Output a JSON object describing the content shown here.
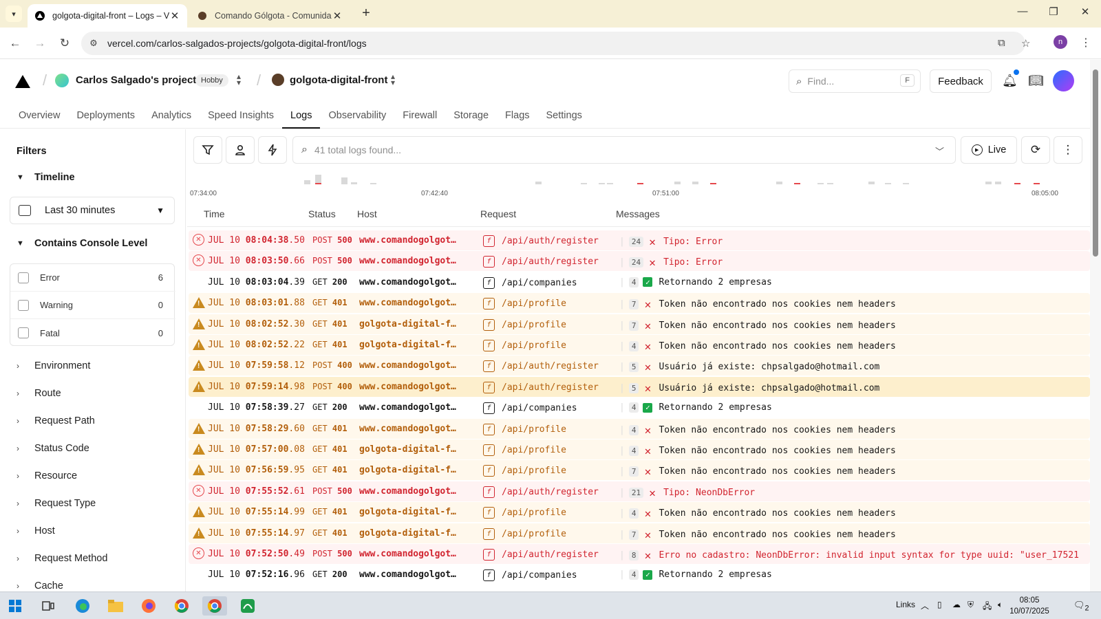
{
  "browser": {
    "tabs": [
      {
        "title": "golgota-digital-front – Logs – V",
        "active": true
      },
      {
        "title": "Comando Gólgota - Comunidad",
        "active": false
      }
    ],
    "url": "vercel.com/carlos-salgados-projects/golgota-digital-front/logs",
    "profile_initial": "n"
  },
  "header": {
    "project_owner": "Carlos Salgado's projects",
    "plan_badge": "Hobby",
    "repo": "golgota-digital-front",
    "find_placeholder": "Find...",
    "find_shortcut": "F",
    "feedback_label": "Feedback",
    "nav_tabs": [
      "Overview",
      "Deployments",
      "Analytics",
      "Speed Insights",
      "Logs",
      "Observability",
      "Firewall",
      "Storage",
      "Flags",
      "Settings"
    ],
    "active_tab": "Logs"
  },
  "sidebar": {
    "title": "Filters",
    "timeline_label": "Timeline",
    "timeline_value": "Last 30 minutes",
    "console_level_label": "Contains Console Level",
    "levels": [
      {
        "label": "Error",
        "count": "6"
      },
      {
        "label": "Warning",
        "count": "0"
      },
      {
        "label": "Fatal",
        "count": "0"
      }
    ],
    "filters": [
      "Environment",
      "Route",
      "Request Path",
      "Status Code",
      "Resource",
      "Request Type",
      "Host",
      "Request Method",
      "Cache"
    ]
  },
  "toolbar": {
    "search_placeholder": "41 total logs found...",
    "live_label": "Live"
  },
  "timeline_labels": [
    "07:34:00",
    "07:42:40",
    "07:51:00",
    "08:05:00"
  ],
  "table": {
    "headers": [
      "Time",
      "Status",
      "Host",
      "Request",
      "Messages"
    ],
    "rows": [
      {
        "level": "err",
        "date": "JUL 10",
        "time": "08:04:38",
        "ms": ".50",
        "method": "POST",
        "status": "500",
        "host": "www.comandogolgot…",
        "path": "/api/auth/register",
        "count": "24",
        "icon": "x",
        "message": "Tipo: Error"
      },
      {
        "level": "err",
        "date": "JUL 10",
        "time": "08:03:50",
        "ms": ".66",
        "method": "POST",
        "status": "500",
        "host": "www.comandogolgot…",
        "path": "/api/auth/register",
        "count": "24",
        "icon": "x",
        "message": "Tipo: Error"
      },
      {
        "level": "ok",
        "date": "JUL 10",
        "time": "08:03:04",
        "ms": ".39",
        "method": "GET",
        "status": "200",
        "host": "www.comandogolgot…",
        "path": "/api/companies",
        "count": "4",
        "icon": "check",
        "message": "Retornando 2 empresas"
      },
      {
        "level": "warn",
        "date": "JUL 10",
        "time": "08:03:01",
        "ms": ".88",
        "method": "GET",
        "status": "401",
        "host": "www.comandogolgot…",
        "path": "/api/profile",
        "count": "7",
        "icon": "x",
        "message": "Token não encontrado nos cookies nem headers"
      },
      {
        "level": "warn",
        "date": "JUL 10",
        "time": "08:02:52",
        "ms": ".30",
        "method": "GET",
        "status": "401",
        "host": "golgota-digital-f…",
        "path": "/api/profile",
        "count": "7",
        "icon": "x",
        "message": "Token não encontrado nos cookies nem headers"
      },
      {
        "level": "warn",
        "date": "JUL 10",
        "time": "08:02:52",
        "ms": ".22",
        "method": "GET",
        "status": "401",
        "host": "golgota-digital-f…",
        "path": "/api/profile",
        "count": "4",
        "icon": "x",
        "message": "Token não encontrado nos cookies nem headers"
      },
      {
        "level": "warn",
        "date": "JUL 10",
        "time": "07:59:58",
        "ms": ".12",
        "method": "POST",
        "status": "400",
        "host": "www.comandogolgot…",
        "path": "/api/auth/register",
        "count": "5",
        "icon": "x",
        "message": "Usuário já existe: chpsalgado@hotmail.com"
      },
      {
        "level": "warn",
        "date": "JUL 10",
        "time": "07:59:14",
        "ms": ".98",
        "method": "POST",
        "status": "400",
        "host": "www.comandogolgot…",
        "path": "/api/auth/register",
        "count": "5",
        "icon": "x",
        "message": "Usuário já existe: chpsalgado@hotmail.com",
        "highlight": true
      },
      {
        "level": "ok",
        "date": "JUL 10",
        "time": "07:58:39",
        "ms": ".27",
        "method": "GET",
        "status": "200",
        "host": "www.comandogolgot…",
        "path": "/api/companies",
        "count": "4",
        "icon": "check",
        "message": "Retornando 2 empresas"
      },
      {
        "level": "warn",
        "date": "JUL 10",
        "time": "07:58:29",
        "ms": ".60",
        "method": "GET",
        "status": "401",
        "host": "www.comandogolgot…",
        "path": "/api/profile",
        "count": "4",
        "icon": "x",
        "message": "Token não encontrado nos cookies nem headers"
      },
      {
        "level": "warn",
        "date": "JUL 10",
        "time": "07:57:00",
        "ms": ".08",
        "method": "GET",
        "status": "401",
        "host": "golgota-digital-f…",
        "path": "/api/profile",
        "count": "4",
        "icon": "x",
        "message": "Token não encontrado nos cookies nem headers"
      },
      {
        "level": "warn",
        "date": "JUL 10",
        "time": "07:56:59",
        "ms": ".95",
        "method": "GET",
        "status": "401",
        "host": "golgota-digital-f…",
        "path": "/api/profile",
        "count": "7",
        "icon": "x",
        "message": "Token não encontrado nos cookies nem headers"
      },
      {
        "level": "err",
        "date": "JUL 10",
        "time": "07:55:52",
        "ms": ".61",
        "method": "POST",
        "status": "500",
        "host": "www.comandogolgot…",
        "path": "/api/auth/register",
        "count": "21",
        "icon": "x",
        "message": "Tipo: NeonDbError"
      },
      {
        "level": "warn",
        "date": "JUL 10",
        "time": "07:55:14",
        "ms": ".99",
        "method": "GET",
        "status": "401",
        "host": "golgota-digital-f…",
        "path": "/api/profile",
        "count": "4",
        "icon": "x",
        "message": "Token não encontrado nos cookies nem headers"
      },
      {
        "level": "warn",
        "date": "JUL 10",
        "time": "07:55:14",
        "ms": ".97",
        "method": "GET",
        "status": "401",
        "host": "golgota-digital-f…",
        "path": "/api/profile",
        "count": "7",
        "icon": "x",
        "message": "Token não encontrado nos cookies nem headers"
      },
      {
        "level": "err",
        "date": "JUL 10",
        "time": "07:52:50",
        "ms": ".49",
        "method": "POST",
        "status": "500",
        "host": "www.comandogolgot…",
        "path": "/api/auth/register",
        "count": "8",
        "icon": "x",
        "message": "Erro no cadastro: NeonDbError: invalid input syntax for type uuid: \"user_17521"
      },
      {
        "level": "ok",
        "date": "JUL 10",
        "time": "07:52:16",
        "ms": ".96",
        "method": "GET",
        "status": "200",
        "host": "www.comandogolgot…",
        "path": "/api/companies",
        "count": "4",
        "icon": "check",
        "message": "Retornando 2 empresas"
      }
    ]
  },
  "taskbar": {
    "links_label": "Links",
    "time": "08:05",
    "date": "10/07/2025",
    "notification_count": "2"
  },
  "colors": {
    "error": "#d1242f",
    "warning": "#b25e0a",
    "success": "#1aa84a",
    "accent": "#0a72ef"
  }
}
